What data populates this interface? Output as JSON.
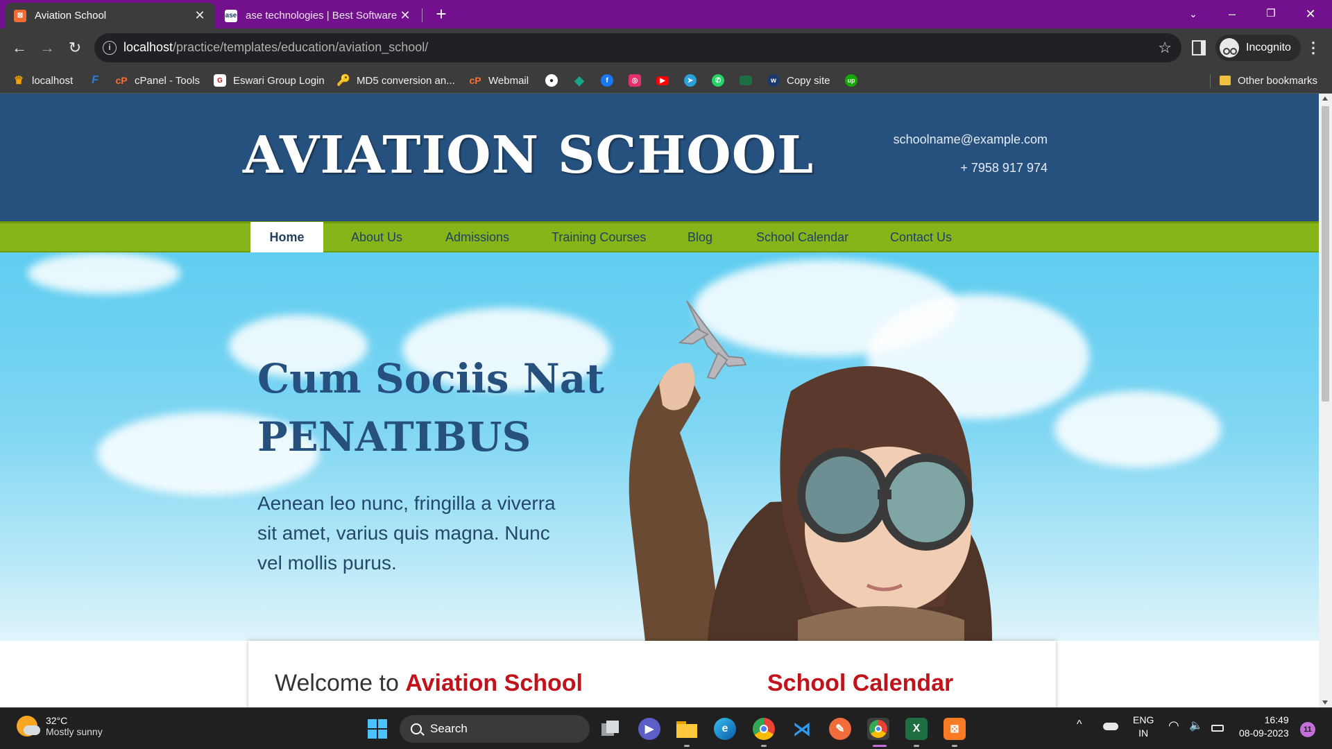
{
  "browser": {
    "tabs": [
      {
        "title": "Aviation School",
        "active": true,
        "favicon_color": "#ef6c35"
      },
      {
        "title": "ase technologies | Best Software",
        "active": false,
        "favicon_color": "#ffffff"
      }
    ],
    "new_tab_label": "+",
    "address": {
      "host": "localhost",
      "path": "/practice/templates/education/aviation_school/"
    },
    "profile_label": "Incognito",
    "bookmarks": [
      {
        "label": "localhost",
        "icon": "xampp-icon",
        "color": "#f4a300"
      },
      {
        "label": "",
        "icon": "f-logo-icon",
        "color": "#2a7de1"
      },
      {
        "label": "cPanel - Tools",
        "icon": "cpanel-icon",
        "color": "#ff6c2c"
      },
      {
        "label": "Eswari Group Login",
        "icon": "eswari-icon",
        "color": "#ffffff"
      },
      {
        "label": "MD5 conversion an...",
        "icon": "key-icon",
        "color": "#f0c040"
      },
      {
        "label": "Webmail",
        "icon": "cpanel-icon",
        "color": "#ff6c2c"
      },
      {
        "label": "",
        "icon": "github-icon",
        "color": "#ffffff"
      },
      {
        "label": "",
        "icon": "diamond-icon",
        "color": "#17a589"
      },
      {
        "label": "",
        "icon": "facebook-icon",
        "color": "#1877f2"
      },
      {
        "label": "",
        "icon": "instagram-icon",
        "color": "#e1306c"
      },
      {
        "label": "",
        "icon": "youtube-icon",
        "color": "#ff0000"
      },
      {
        "label": "",
        "icon": "telegram-icon",
        "color": "#2aa1da"
      },
      {
        "label": "",
        "icon": "whatsapp-icon",
        "color": "#25d366"
      },
      {
        "label": "",
        "icon": "folder-green-icon",
        "color": "#1d6f42"
      },
      {
        "label": "Copy site",
        "icon": "w-icon",
        "color": "#1b3a6b"
      },
      {
        "label": "",
        "icon": "upwork-icon",
        "color": "#14a800"
      }
    ],
    "other_bookmarks": "Other bookmarks"
  },
  "site": {
    "title": "AVIATION SCHOOL",
    "email": "schoolname@example.com",
    "phone": "+ 7958 917 974",
    "nav": [
      "Home",
      "About Us",
      "Admissions",
      "Training Courses",
      "Blog",
      "School Calendar",
      "Contact Us"
    ],
    "hero": {
      "line1": "Cum Sociis Nat",
      "line2": "PENATIBUS",
      "text": "Aenean leo nunc, fringilla a viverra sit amet, varius quis magna. Nunc vel mollis purus."
    },
    "welcome_prefix": "Welcome to ",
    "welcome_highlight": "Aviation School",
    "calendar_title": "School Calendar"
  },
  "taskbar": {
    "weather_temp": "32°C",
    "weather_desc": "Mostly sunny",
    "search_label": "Search",
    "lang_top": "ENG",
    "lang_bottom": "IN",
    "time": "16:49",
    "date": "08-09-2023",
    "notifications": "11"
  },
  "colors": {
    "header_blue": "#26507e",
    "nav_green": "#85b518",
    "accent_red": "#c1131b",
    "tabstrip_purple": "#73108d"
  }
}
